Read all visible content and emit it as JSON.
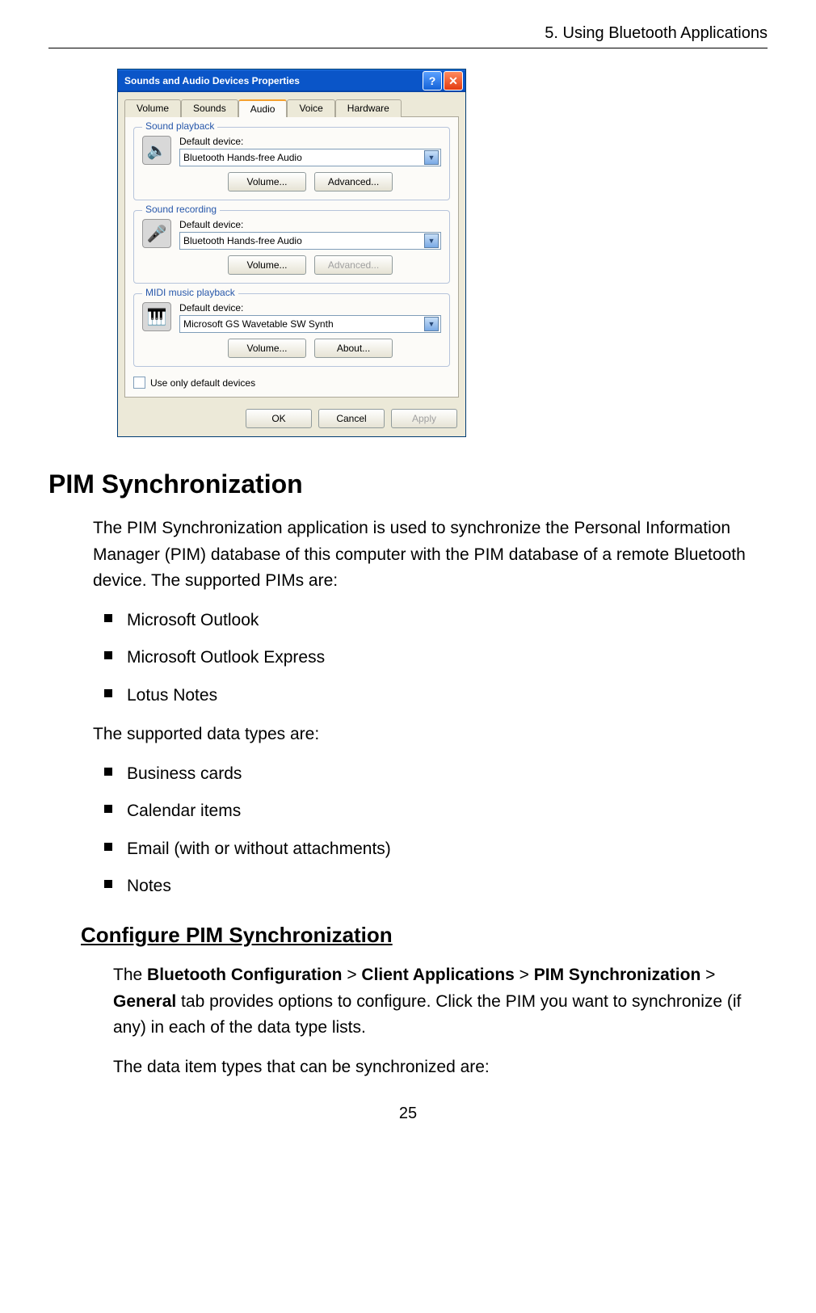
{
  "header": "5. Using Bluetooth Applications",
  "dialog": {
    "title": "Sounds and Audio Devices Properties",
    "tabs": [
      "Volume",
      "Sounds",
      "Audio",
      "Voice",
      "Hardware"
    ],
    "active_tab": "Audio",
    "groups": {
      "playback": {
        "label": "Sound playback",
        "field_label": "Default device:",
        "device": "Bluetooth Hands-free Audio",
        "btn1": "Volume...",
        "btn2": "Advanced...",
        "icon": "🔈"
      },
      "recording": {
        "label": "Sound recording",
        "field_label": "Default device:",
        "device": "Bluetooth Hands-free Audio",
        "btn1": "Volume...",
        "btn2": "Advanced...",
        "icon": "🎤"
      },
      "midi": {
        "label": "MIDI music playback",
        "field_label": "Default device:",
        "device": "Microsoft GS Wavetable SW Synth",
        "btn1": "Volume...",
        "btn2": "About...",
        "icon": "🎹"
      }
    },
    "checkbox": "Use only default devices",
    "ok": "OK",
    "cancel": "Cancel",
    "apply": "Apply"
  },
  "section_title": "PIM Synchronization",
  "para1": "The PIM Synchronization application is used to synchronize the Personal Information Manager (PIM) database of this computer with the PIM database of a remote Bluetooth device. The supported PIMs are:",
  "list1": [
    "Microsoft Outlook",
    "Microsoft Outlook Express",
    "Lotus Notes"
  ],
  "para2": "The supported data types are:",
  "list2": [
    "Business cards",
    "Calendar items",
    "Email (with or without attachments)",
    "Notes"
  ],
  "sub_title": "Configure PIM Synchronization",
  "para3_pre": "The ",
  "para3_b1": "Bluetooth Configuration",
  "para3_s1": " > ",
  "para3_b2": "Client Applications",
  "para3_s2": " > ",
  "para3_b3": "PIM Synchronization",
  "para3_s3": " > ",
  "para3_b4": "General",
  "para3_post": " tab provides options to configure. Click the PIM you want to synchronize (if any) in each of the data type lists.",
  "para4": "The data item types that can be synchronized are:",
  "page_number": "25"
}
